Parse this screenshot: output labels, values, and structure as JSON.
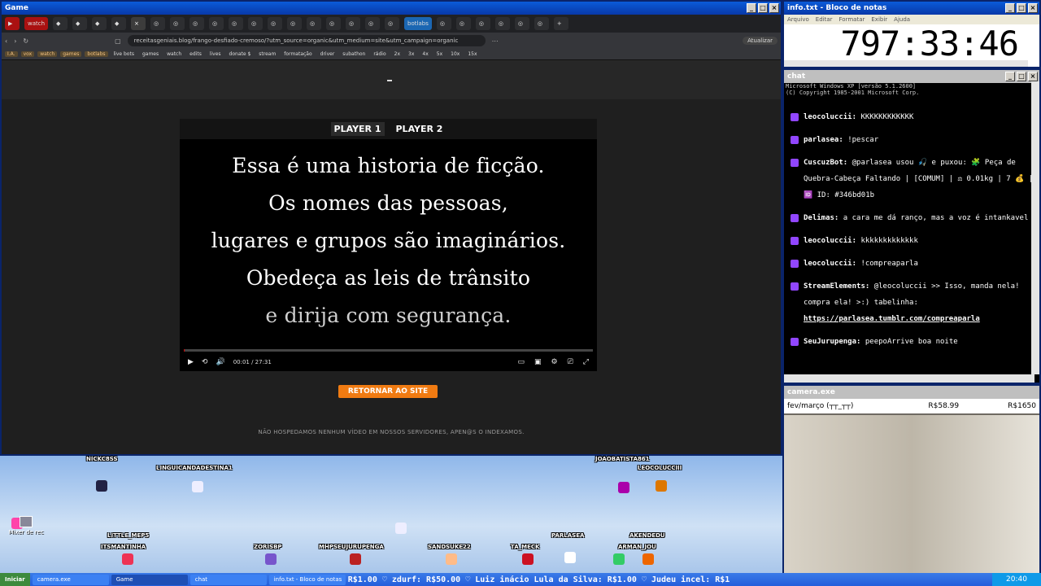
{
  "game_window": {
    "title": "Game",
    "tabs": [
      "watch",
      "botlabs"
    ],
    "url": "receitasgeniais.blog/frango-desfiado-cremoso/?utm_source=organic&utm_medium=site&utm_campaign=organic",
    "update_label": "Atualizar",
    "bookmarks": [
      "I.A.",
      "vox",
      "watch",
      "games",
      "botlabs",
      "live bots",
      "games",
      "watch",
      "edits",
      "lives",
      "donate $",
      "stream",
      "formatação",
      "driver",
      "subathon",
      "rádio",
      "2x",
      "3x",
      "4x",
      "5x",
      "10x",
      "15x"
    ]
  },
  "player": {
    "tab1": "PLAYER 1",
    "tab2": "PLAYER 2",
    "subtitle": {
      "line1": "Essa é uma historia de ficção.",
      "line2": "Os nomes das pessoas,",
      "line3": "lugares e grupos são imaginários.",
      "line4": "Obedeça as leis de trânsito",
      "line5": "e dirija com segurança."
    },
    "time": "00:01 / 27:31",
    "progress": 0.001
  },
  "page": {
    "return_button": "RETORNAR AO SITE",
    "disclaimer": "NÃO HOSPEDAMOS NENHUM VÍDEO EM NOSSOS SERVIDORES, APEN@S O INDEXAMOS."
  },
  "overlay": {
    "users": [
      "NICKC8SS",
      "LINGUICANDADESTINA1",
      "JOAOBATISTA861",
      "LEOCOLUCCIII",
      "LITTLE_MEP5",
      "ITSMANTINHA",
      "ZORISBP",
      "MHPSEUJURUPENGA",
      "SANDSUKE22",
      "TA_MECK",
      "PARLASEA",
      "AKENDEDU",
      "ARMAN_JOU"
    ],
    "desktop_icon": "Mixer de rec"
  },
  "notepad": {
    "title": "info.txt - Bloco de notas",
    "menu": [
      "Arquivo",
      "Editar",
      "Formatar",
      "Exibir",
      "Ajuda"
    ],
    "timer": "797:33:46"
  },
  "chat": {
    "title": "chat",
    "header1": "Microsoft Windows XP [versão 5.1.2600]",
    "header2": "(C) Copyright 1985-2001 Microsoft Corp.",
    "messages": [
      {
        "user": "leocoluccii:",
        "text": "KKKKKKKKKKKK"
      },
      {
        "user": "parlasea:",
        "text": "!pescar"
      },
      {
        "user": "CuscuzBot:",
        "text": "@parlasea usou 🎣 e puxou: 🧩 Peça de Quebra-Cabeça Faltando | [COMUM] | ⚖ 0.01kg | 7 💰 | 🆔 ID: #346bd01b"
      },
      {
        "user": "Delimas:",
        "text": "a cara me dá ranço, mas a voz é intankavel"
      },
      {
        "user": "leocoluccii:",
        "text": "kkkkkkkkkkkkk"
      },
      {
        "user": "leocoluccii:",
        "text": "!compreaparla"
      },
      {
        "user": "StreamElements:",
        "text": "@leocoluccii >> Isso, manda nela! compra ela! >:) tabelinha:",
        "link": "https://parlasea.tumblr.com/compreaparla"
      },
      {
        "user": "SeuJurupenga:",
        "text": "peepoArrive boa noite"
      }
    ]
  },
  "camera": {
    "title": "camera.exe",
    "left_label": "fev/março (┬┬_┬┬)",
    "mid_value": "R$58.99",
    "right_value": "R$1650"
  },
  "taskbar": {
    "start": "Iniciar",
    "tasks": [
      "camera.exe",
      "Game",
      "chat",
      "info.txt - Bloco de notas"
    ],
    "ticker": "R$1.00 ♡ zdurf: R$50.00 ♡ Luiz inácio Lula da Silva: R$1.00 ♡ Judeu incel: R$1",
    "clock": "20:40"
  },
  "colors": {
    "accent": "#f07b12",
    "xp_blue": "#245edb",
    "chat_badge": "#9146ff"
  }
}
